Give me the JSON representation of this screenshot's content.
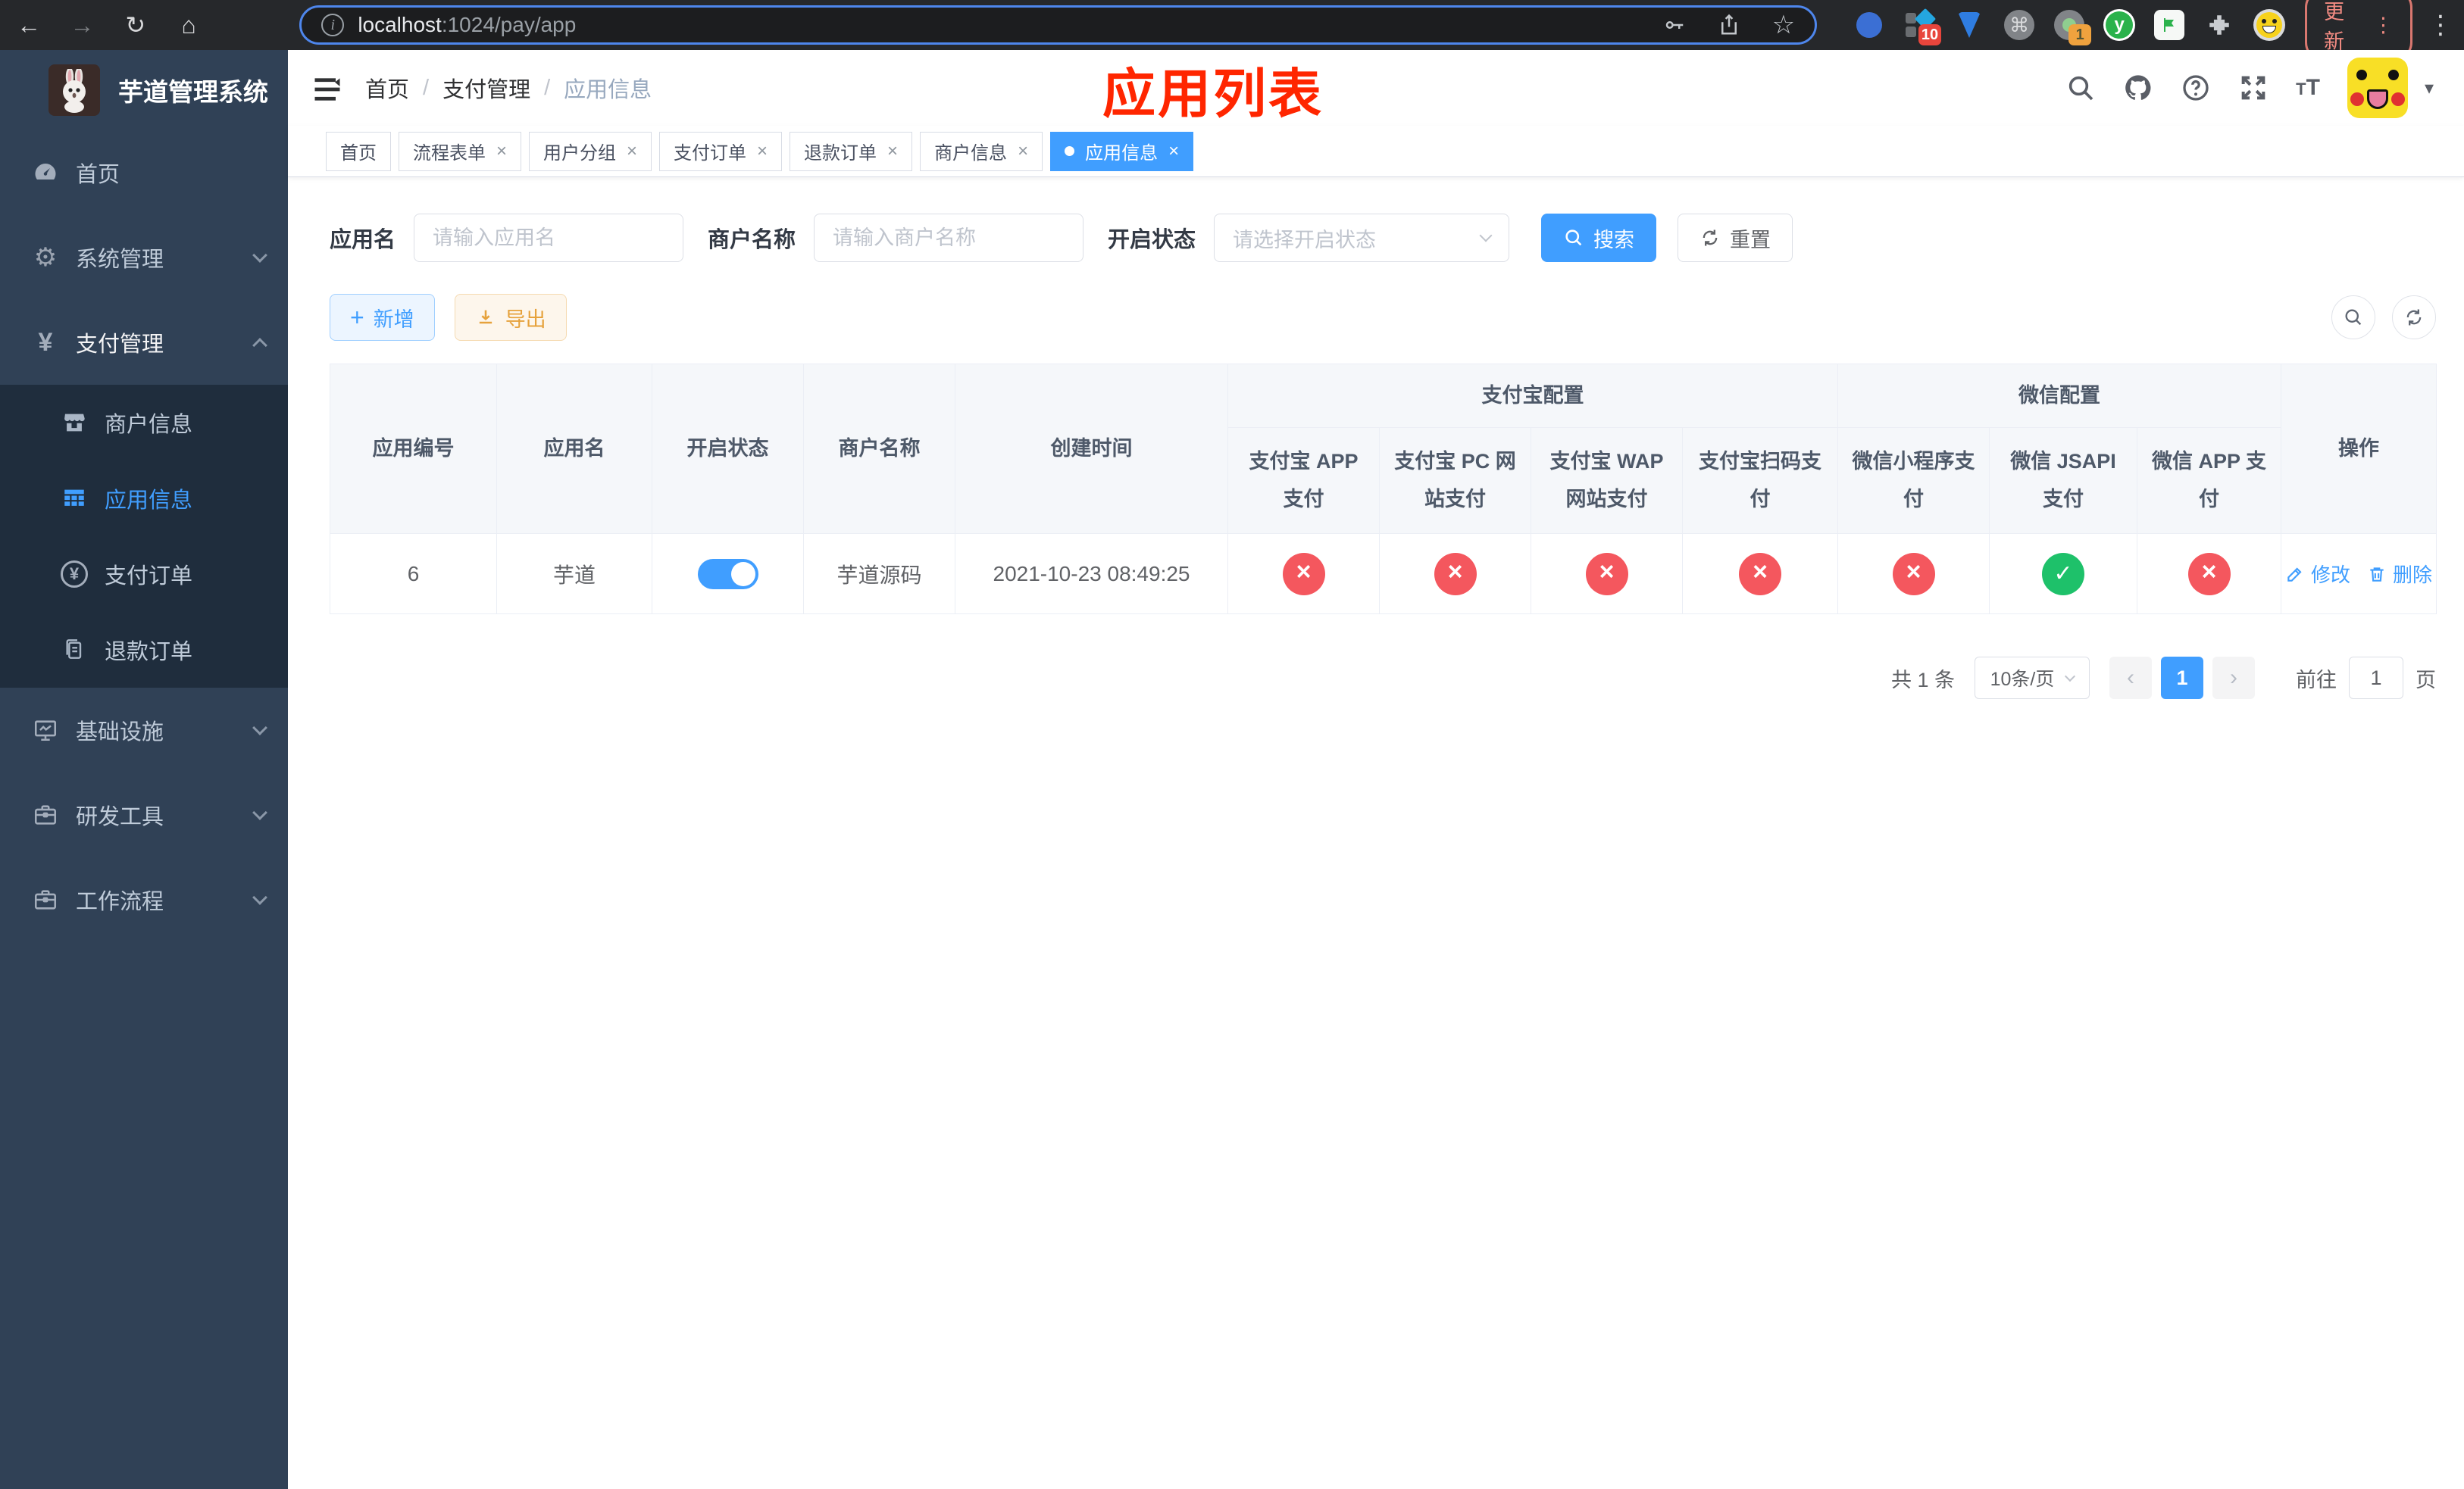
{
  "colors": {
    "accent": "#409eff",
    "danger": "#f56c6c",
    "success": "#1ec16a",
    "warning": "#e6a23c",
    "sidebar": "#304156",
    "annotation_red": "#ff2600"
  },
  "browser": {
    "url_host": "localhost",
    "url_rest": ":1024/pay/app",
    "update_label": "更新",
    "ext_badge_10": "10",
    "ext_badge_1": "1",
    "green_ext_letter": "y"
  },
  "glyphs": {
    "back": "←",
    "forward": "→",
    "reload": "↻",
    "home": "⌂",
    "star": "☆",
    "command": "⌘",
    "kebab": "⋮",
    "caret": "▾",
    "sep": "/",
    "close": "×",
    "prev": "‹",
    "next": "›",
    "plus": "+",
    "yen": "¥",
    "gear": "⚙",
    "question": "?",
    "coin_yen": "¥",
    "t_small": "T",
    "t_large": "T"
  },
  "app": {
    "title": "芋道管理系统"
  },
  "sidebar": {
    "items": [
      {
        "label": "首页",
        "icon": "dashboard-icon"
      },
      {
        "label": "系统管理",
        "icon": "gear-icon"
      },
      {
        "label": "支付管理",
        "icon": "yen-icon"
      },
      {
        "label": "商户信息",
        "icon": "shop-icon"
      },
      {
        "label": "应用信息",
        "icon": "grid-icon"
      },
      {
        "label": "支付订单",
        "icon": "coin-icon"
      },
      {
        "label": "退款订单",
        "icon": "document-icon"
      },
      {
        "label": "基础设施",
        "icon": "monitor-icon"
      },
      {
        "label": "研发工具",
        "icon": "toolbox-icon"
      },
      {
        "label": "工作流程",
        "icon": "toolbox-icon"
      }
    ]
  },
  "breadcrumb": {
    "items": [
      "首页",
      "支付管理",
      "应用信息"
    ]
  },
  "annotation": {
    "text": "应用列表"
  },
  "tabs": [
    {
      "label": "首页"
    },
    {
      "label": "流程表单"
    },
    {
      "label": "用户分组"
    },
    {
      "label": "支付订单"
    },
    {
      "label": "退款订单"
    },
    {
      "label": "商户信息"
    },
    {
      "label": "应用信息"
    }
  ],
  "filters": {
    "app_name_label": "应用名",
    "app_name_placeholder": "请输入应用名",
    "merchant_label": "商户名称",
    "merchant_placeholder": "请输入商户名称",
    "status_label": "开启状态",
    "status_placeholder": "请选择开启状态",
    "search_label": "搜索",
    "reset_label": "重置"
  },
  "toolbar": {
    "add_label": "新增",
    "export_label": "导出"
  },
  "table": {
    "col_headers": {
      "app_id": "应用编号",
      "app_name": "应用名",
      "status": "开启状态",
      "merchant": "商户名称",
      "created": "创建时间",
      "alipay_group": "支付宝配置",
      "wechat_group": "微信配置",
      "alipay_app": "支付宝 APP 支付",
      "alipay_pc": "支付宝 PC 网站支付",
      "alipay_wap": "支付宝 WAP 网站支付",
      "alipay_qr": "支付宝扫码支付",
      "wx_mini": "微信小程序支付",
      "wx_jsapi": "微信 JSAPI 支付",
      "wx_app": "微信 APP 支付",
      "actions": "操作"
    },
    "row": {
      "app_id": "6",
      "app_name": "芋道",
      "enabled": true,
      "merchant": "芋道源码",
      "created": "2021-10-23 08:49:25",
      "statuses": [
        "fail",
        "fail",
        "fail",
        "fail",
        "fail",
        "pass",
        "fail"
      ],
      "edit_label": "修改",
      "delete_label": "删除"
    }
  },
  "pagination": {
    "total": "共 1 条",
    "page_size": "10条/页",
    "page": "1",
    "goto_label": "前往",
    "goto_value": "1",
    "page_unit": "页"
  }
}
